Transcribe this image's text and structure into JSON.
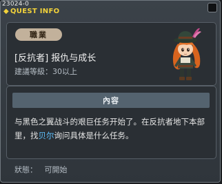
{
  "window": {
    "quest_id": "23024-0",
    "title": "QUEST INFO"
  },
  "quest": {
    "job_label": "職業",
    "name": "[反抗者] 报仇与成长",
    "level_text": "建議等級：30以上"
  },
  "content": {
    "header": "內容",
    "description_pre": "与黑色之翼战斗的艰巨任务开始了。在反抗者地下本部里，找",
    "npc_name": "贝尔",
    "description_post": "询问具体是什么任务。"
  },
  "status": {
    "text": "狀態：   可開始"
  },
  "colors": {
    "title": "#f2d23a",
    "npc_highlight": "#5ec2ff",
    "job_pill": "#c2b19b"
  },
  "icons": {
    "title_icon": "diamond-icon",
    "close": "close-icon"
  }
}
